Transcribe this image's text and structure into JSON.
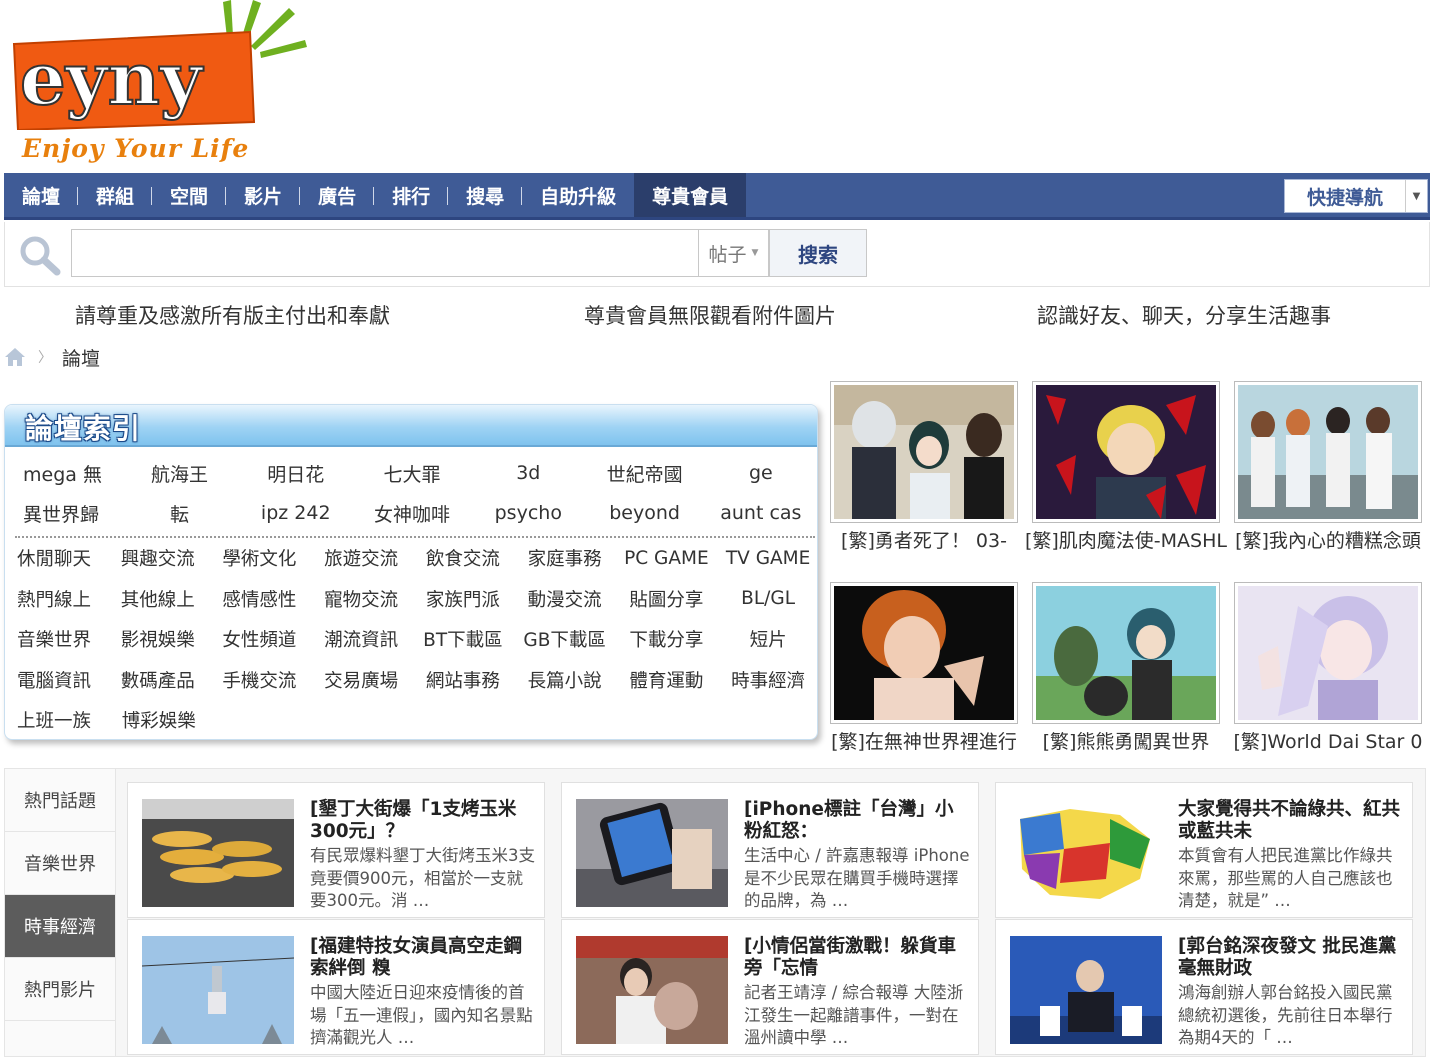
{
  "logo": {
    "word": "eyny",
    "tagline": "Enjoy Your Life"
  },
  "nav": {
    "items": [
      "論壇",
      "群組",
      "空間",
      "影片",
      "廣告",
      "排行",
      "搜尋",
      "自助升級",
      "尊貴會員"
    ],
    "quick_nav": "快捷導航"
  },
  "search": {
    "type": "帖子",
    "button": "搜索",
    "placeholder": ""
  },
  "slogans": [
    "請尊重及感激所有版主付出和奉獻",
    "尊貴會員無限觀看附件圖片",
    "認識好友、聊天，分享生活趣事"
  ],
  "breadcrumb": {
    "current": "論壇"
  },
  "forum_index": {
    "title": "論壇索引",
    "tags": [
      [
        "mega 無",
        "航海王",
        "明日花",
        "七大罪",
        "3d",
        "世紀帝國",
        "ge"
      ],
      [
        "異世界歸",
        "転",
        "ipz 242",
        "女神咖啡",
        "psycho",
        "beyond",
        "aunt cas"
      ]
    ],
    "boards": [
      [
        "休閒聊天",
        "興趣交流",
        "學術文化",
        "旅遊交流",
        "飲食交流",
        "家庭事務",
        "PC GAME",
        "TV GAME"
      ],
      [
        "熱門線上",
        "其他線上",
        "感情感性",
        "寵物交流",
        "家族門派",
        "動漫交流",
        "貼圖分享",
        "BL/GL"
      ],
      [
        "音樂世界",
        "影視娛樂",
        "女性頻道",
        "潮流資訊",
        "BT下載區",
        "GB下載區",
        "下載分享",
        "短片"
      ],
      [
        "電腦資訊",
        "數碼產品",
        "手機交流",
        "交易廣場",
        "網站事務",
        "長篇小說",
        "體育運動",
        "時事經濟"
      ],
      [
        "上班一族",
        "博彩娛樂"
      ]
    ]
  },
  "thumbs": [
    {
      "caption": "[繁]勇者死了！ 03-"
    },
    {
      "caption": "[繁]肌肉魔法使-MASHL"
    },
    {
      "caption": "[繁]我內心的糟糕念頭"
    },
    {
      "caption": "[繁]在無神世界裡進行"
    },
    {
      "caption": "[繁]熊熊勇闖異世界"
    },
    {
      "caption": "[繁]World Dai Star 0"
    }
  ],
  "tabs": [
    "熱門話題",
    "音樂世界",
    "時事經濟",
    "熱門影片"
  ],
  "news": [
    {
      "title": "[墾丁大街爆「1支烤玉米300元」？",
      "desc": "有民眾爆料墾丁大街烤玉米3支竟要價900元，相當於一支就要300元。消 …"
    },
    {
      "title": "[iPhone標註「台灣」小粉紅怒：",
      "desc": "生活中心 / 許嘉惠報導 iPhone是不少民眾在購買手機時選擇的品牌，為 …"
    },
    {
      "title": "大家覺得共不論綠共、紅共或藍共未",
      "desc": "本質會有人把民進黨比作綠共來罵，那些罵的人自己應該也清楚，就是” …"
    },
    {
      "title": "[福建特技女演員高空走鋼索絆倒 糗",
      "desc": "中國大陸近日迎來疫情後的首場「五一連假」，國內知名景點擠滿觀光人 …"
    },
    {
      "title": "[小情侶當街激戰！躲貨車旁「忘情",
      "desc": "記者王靖淳 / 綜合報導 大陸浙江發生一起離譜事件，一對在溫州讀中學 …"
    },
    {
      "title": "[郭台銘深夜發文 批民進黨毫無財政",
      "desc": "鴻海創辦人郭台銘投入國民黨總統初選後，先前往日本舉行為期4天的「 …"
    }
  ],
  "colors": {
    "nav_bg": "#3f5b96",
    "logo_orange": "#f05a12",
    "index_blue": "#7fc3ee"
  }
}
